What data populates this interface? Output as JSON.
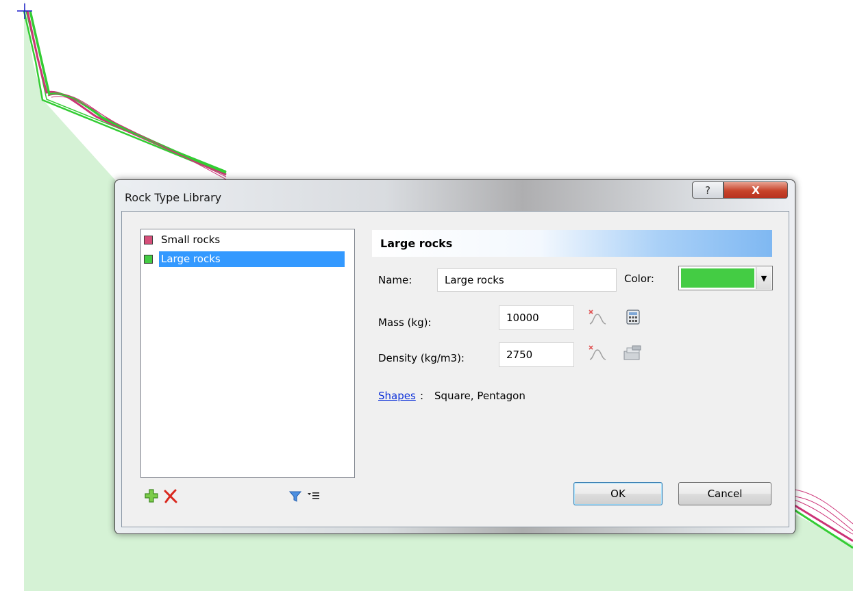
{
  "dialog": {
    "title": "Rock Type Library",
    "help_glyph": "?",
    "close_glyph": "X"
  },
  "rock_types": [
    {
      "label": "Small rocks",
      "color": "#d64f7a",
      "selected": false
    },
    {
      "label": "Large rocks",
      "color": "#44cc44",
      "selected": true
    }
  ],
  "details": {
    "header": "Large rocks",
    "name_label": "Name:",
    "name_value": "Large rocks",
    "color_label": "Color:",
    "color_value": "#44cc44",
    "mass_label": "Mass (kg):",
    "mass_value": "10000",
    "density_label": "Density (kg/m3):",
    "density_value": "2750",
    "shapes_link": "Shapes",
    "shapes_colon": ":",
    "shapes_value": "Square, Pentagon"
  },
  "buttons": {
    "ok": "OK",
    "cancel": "Cancel"
  },
  "icons": {
    "add": "add-icon",
    "delete": "delete-icon",
    "filter": "filter-icon",
    "list_options": "list-options-icon",
    "mass_distribution": "statistical-distribution-icon",
    "calculator": "calculator-icon",
    "density_distribution": "statistical-distribution-icon",
    "material_library": "material-library-icon"
  },
  "colors": {
    "ground_fill": "#d5f2d5",
    "path_green": "#33cc33",
    "path_pink": "#cc3377",
    "selection": "#3399ff",
    "close_button": "#c7432a"
  }
}
